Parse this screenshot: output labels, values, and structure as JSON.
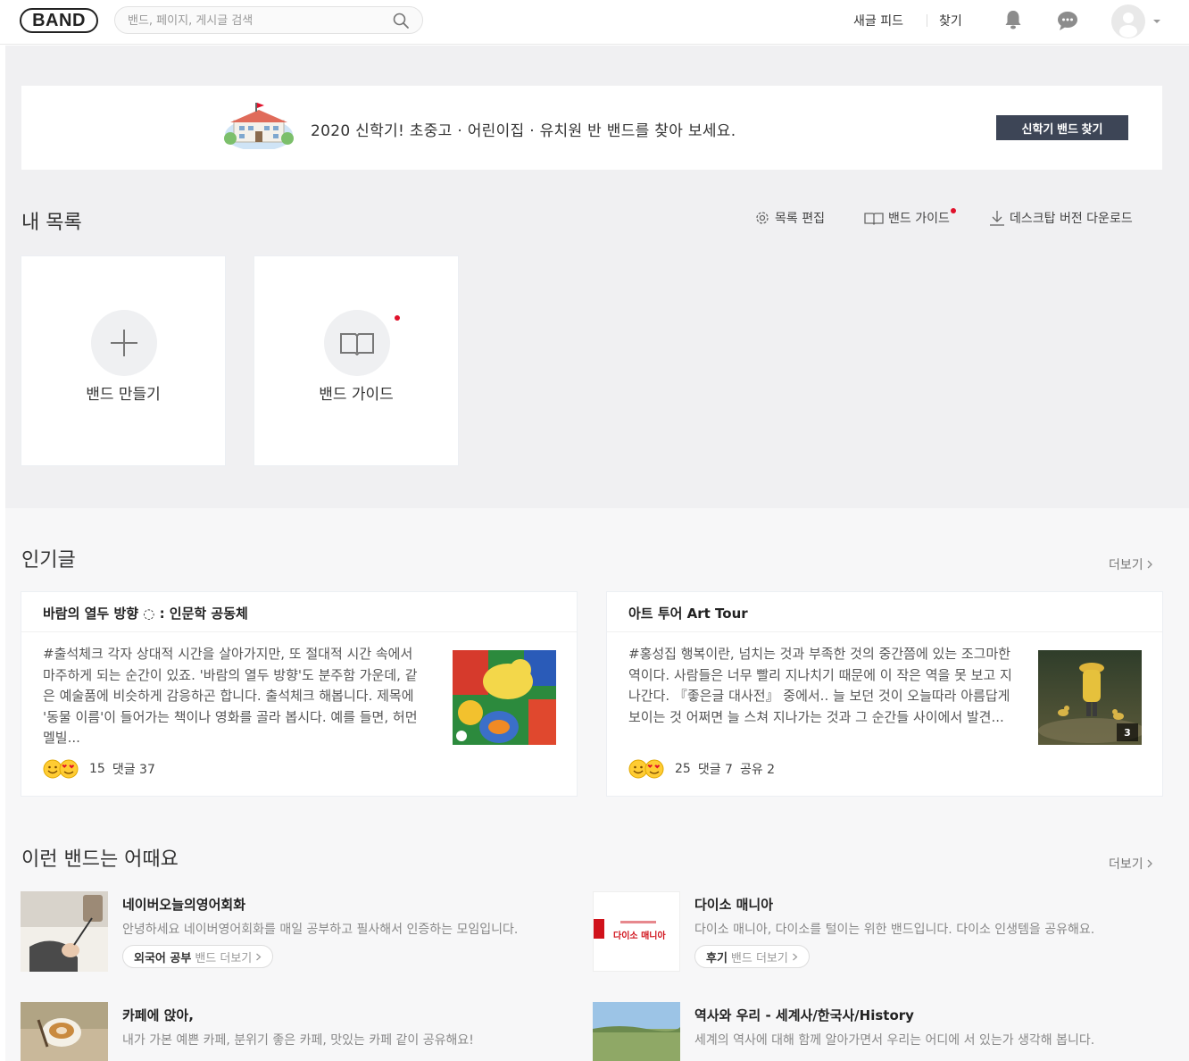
{
  "header": {
    "logo": "BAND",
    "search_placeholder": "밴드, 페이지, 게시글 검색",
    "nav_feed": "새글 피드",
    "nav_find": "찾기"
  },
  "banner": {
    "text": "2020 신학기! 초중고 · 어린이집 · 유치원 반 밴드를 찾아 보세요.",
    "button": "신학기 밴드 찾기"
  },
  "mylist": {
    "title": "내 목록",
    "edit_label": "목록 편집",
    "guide_label": "밴드 가이드",
    "download_label": "데스크탑 버전 다운로드",
    "create_card": "밴드 만들기",
    "guide_card": "밴드 가이드"
  },
  "popular": {
    "title": "인기글",
    "more": "더보기",
    "posts": [
      {
        "band": "바람의 열두 방향 ◌ : 인문학 공동체",
        "body": "#출석체크 각자 상대적 시간을 살아가지만, 또 절대적 시간 속에서 마주하게 되는 순간이 있죠. '바람의 열두 방향'도 분주함 가운데, 같은 예술품에 비슷하게 감응하곤 합니다. 출석체크 해봅니다. 제목에 '동물 이름'이 들어가는 책이나 영화를 골라 봅시다. 예를 들면, 허먼 멜빌...",
        "reactions": "15",
        "comments": "댓글 37",
        "shares": ""
      },
      {
        "band": "아트 투어 Art Tour",
        "body": "#홍성집 행복이란, 넘치는 것과 부족한 것의 중간쯤에 있는 조그마한 역이다. 사람들은 너무 빨리 지나치기 때문에 이 작은 역을 못 보고 지나간다. 『좋은글 대사전』 중에서.. 늘 보던 것이 오늘따라 아름답게 보이는 것 어쩌면 늘 스쳐 지나가는 것과 그 순간들 사이에서 발견...",
        "reactions": "25",
        "comments": "댓글 7",
        "shares": "공유 2",
        "image_count": "3"
      }
    ]
  },
  "recommend": {
    "title": "이런 밴드는 어때요",
    "more": "더보기",
    "bands": [
      {
        "name": "네이버오늘의영어회화",
        "desc": "안녕하세요 네이버영어회화를 매일 공부하고 필사해서 인증하는 모임입니다.",
        "tag": "외국어 공부",
        "tag_more": "밴드 더보기"
      },
      {
        "name": "다이소 매니아",
        "desc": "다이소 매니아, 다이소를 털이는 위한 밴드입니다. 다이소 인생템을 공유해요.",
        "tag": "후기",
        "tag_more": "밴드 더보기",
        "logo_text": "다이소 매니아"
      },
      {
        "name": "카페에 앉아,",
        "desc": "내가 가본 예쁜 카페, 분위기 좋은 카페, 맛있는 카페 같이 공유해요!",
        "tag": "",
        "tag_more": ""
      },
      {
        "name": "역사와 우리 - 세계사/한국사/History",
        "desc": "세계의 역사에 대해 함께 알아가면서 우리는 어디에 서 있는가 생각해 봅니다.",
        "tag": "",
        "tag_more": ""
      }
    ]
  },
  "colors": {
    "accent_dark": "#3d4556",
    "notification_dot": "#e0112b",
    "section_bg": "#f0f0f2"
  }
}
